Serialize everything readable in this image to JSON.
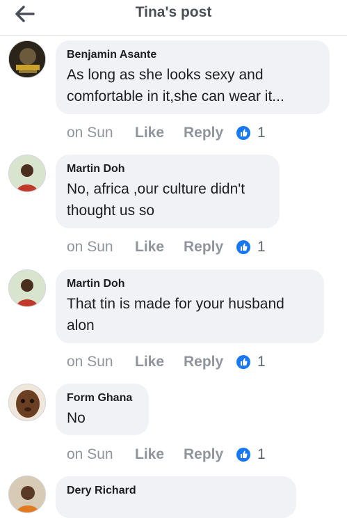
{
  "header": {
    "title": "Tina's post"
  },
  "colors": {
    "accent": "#1877f2",
    "bubble": "#f0f2f5",
    "muted": "#90949c"
  },
  "comments": [
    {
      "author": "Benjamin Asante",
      "lines": [
        "As long as she looks sexy and",
        "comfortable in it,she can wear it..."
      ],
      "time": "on Sun",
      "like_label": "Like",
      "reply_label": "Reply",
      "like_count": "1"
    },
    {
      "author": "Martin Doh",
      "lines": [
        "No, africa ,our culture didn't",
        "thought us so"
      ],
      "time": "on Sun",
      "like_label": "Like",
      "reply_label": "Reply",
      "like_count": "1"
    },
    {
      "author": "Martin Doh",
      "lines": [
        "That tin is made for your husband",
        "alon"
      ],
      "time": "on Sun",
      "like_label": "Like",
      "reply_label": "Reply",
      "like_count": "1"
    },
    {
      "author": "Form Ghana",
      "lines": [
        "No"
      ],
      "time": "on Sun",
      "like_label": "Like",
      "reply_label": "Reply",
      "like_count": "1"
    },
    {
      "author": "Dery Richard",
      "lines": [],
      "time": "",
      "like_label": "",
      "reply_label": "",
      "like_count": ""
    }
  ]
}
